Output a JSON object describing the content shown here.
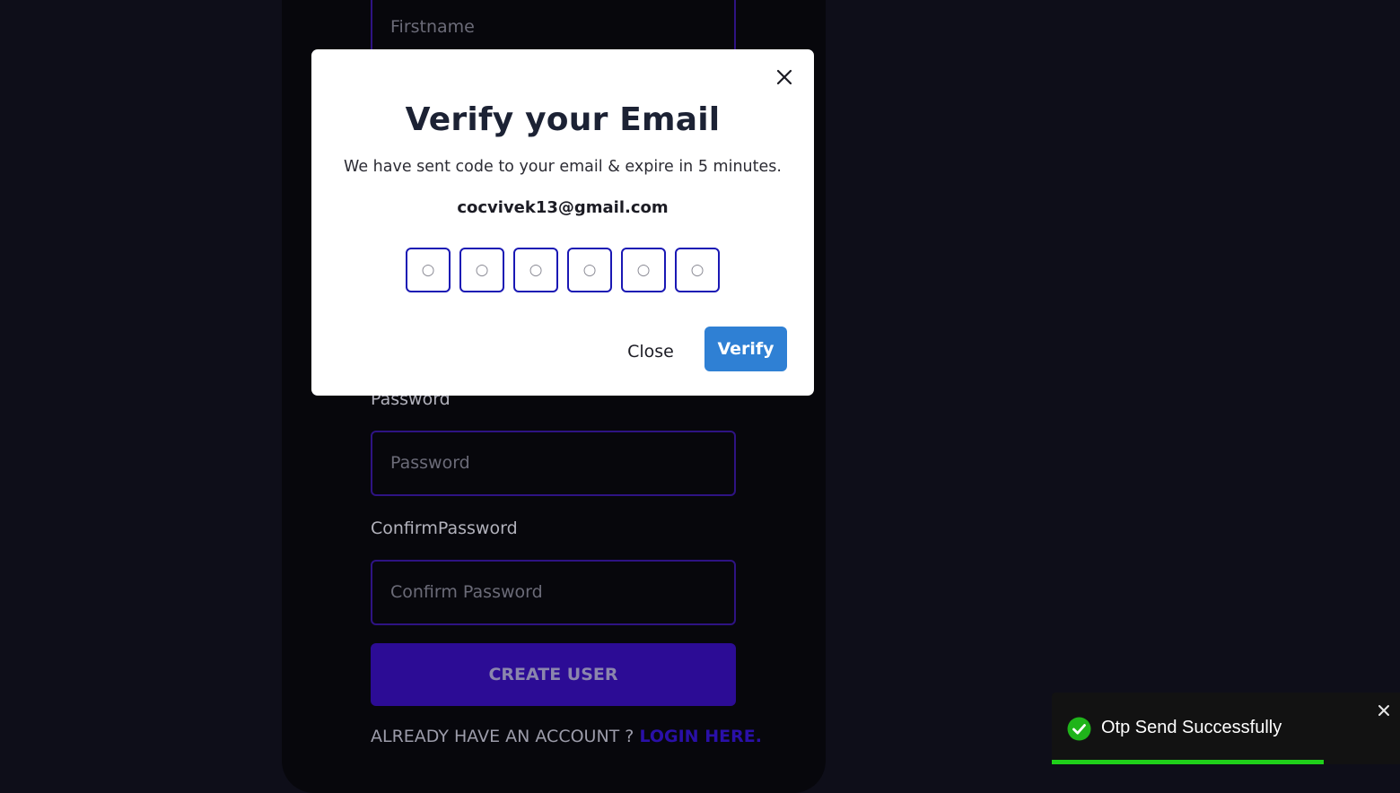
{
  "form": {
    "firstname_placeholder": "Firstname",
    "password_label": "Password",
    "password_placeholder": "Password",
    "confirm_label": "ConfirmPassword",
    "confirm_placeholder": "Confirm Password",
    "create_button": "CREATE USER",
    "already_text": "ALREADY HAVE AN ACCOUNT ? ",
    "login_link": "LOGIN HERE."
  },
  "modal": {
    "title": "Verify your Email",
    "subtitle": "We have sent code to your email & expire in 5 minutes.",
    "email": "cocvivek13@gmail.com",
    "otp_boxes": [
      "○",
      "○",
      "○",
      "○",
      "○",
      "○"
    ],
    "close_label": "Close",
    "verify_label": "Verify",
    "close_icon": "close-icon"
  },
  "toast": {
    "message": "Otp Send Successfully",
    "icon": "check-circle-icon",
    "close_icon": "close-icon",
    "progress": 0.78,
    "progress_color": "#1fcf1a"
  },
  "colors": {
    "background": "#0e0e19",
    "card": "#07070c",
    "input_border": "#2e1383",
    "primary_button": "#2c0c95",
    "verify_button": "#2f80d4",
    "otp_border": "#1a18b4"
  }
}
